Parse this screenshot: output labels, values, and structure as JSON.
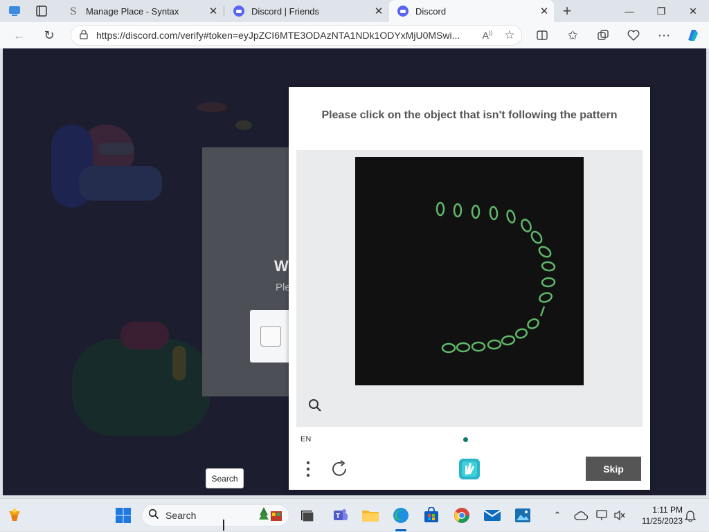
{
  "browser": {
    "tabs": [
      {
        "title": "Manage Place - Syntax",
        "favicon": "syntax-s-icon"
      },
      {
        "title": "Discord | Friends",
        "favicon": "discord-icon"
      },
      {
        "title": "Discord",
        "favicon": "discord-icon",
        "active": true
      }
    ],
    "new_tab": "+",
    "url": "https://discord.com/verify#token=eyJpZCI6MTE3ODAzNTA1NDk1ODYxMjU0MSwi..."
  },
  "page": {
    "heading": "W",
    "subtext": "Ple"
  },
  "captcha": {
    "prompt": "Please click on the object that isn't following the pattern",
    "language": "EN",
    "skip_label": "Skip",
    "accent": "#0f7a6b",
    "ring_color": "#5fb86a"
  },
  "tooltip": "Search",
  "taskbar": {
    "search_placeholder": "Search",
    "time": "1:11 PM",
    "date": "11/25/2023"
  }
}
